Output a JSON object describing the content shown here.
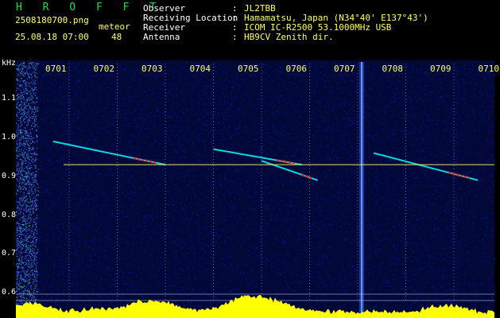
{
  "app": {
    "name": "H R O F F T"
  },
  "file": {
    "filename": "2508180700.png",
    "datetime": "25.08.18 07:00",
    "meteor_label": "meteor",
    "meteor_count": "48"
  },
  "station": {
    "fields": [
      {
        "label": "Observer",
        "sep": ":",
        "value": "JL2TBB"
      },
      {
        "label": "Receiving Location",
        "sep": ":",
        "value": "Hamamatsu, Japan (N34°40' E137°43')"
      },
      {
        "label": "Receiver",
        "sep": ":",
        "value": "ICOM IC-R2500 53.1000MHz USB"
      },
      {
        "label": "Antenna",
        "sep": ":",
        "value": "HB9CV Zenith dir."
      }
    ]
  },
  "chart_data": {
    "type": "heatmap",
    "title": "",
    "xlabel": "",
    "ylabel": "kHz",
    "x_ticks": [
      "0701",
      "0702",
      "0703",
      "0704",
      "0705",
      "0706",
      "0707",
      "0708",
      "0709",
      "0710"
    ],
    "y_ticks": [
      "1.1",
      "1.0",
      "0.9",
      "0.8",
      "0.7",
      "0.6"
    ],
    "ylim": [
      0.57,
      1.18
    ],
    "carrier_khz": 0.93,
    "meteor_echoes": [
      {
        "t_start": "07:00:40",
        "t_end": "07:03:00",
        "khz_start": 0.99,
        "khz_end": 0.93
      },
      {
        "t_start": "07:04:00",
        "t_end": "07:05:50",
        "khz_start": 0.97,
        "khz_end": 0.93
      },
      {
        "t_start": "07:05:00",
        "t_end": "07:06:10",
        "khz_start": 0.94,
        "khz_end": 0.89
      },
      {
        "t_start": "07:07:20",
        "t_end": "07:09:30",
        "khz_start": 0.96,
        "khz_end": 0.89
      }
    ],
    "colors": {
      "background": "#000000",
      "noise": "#0a14a0",
      "echo_low": "#00ffff",
      "echo_high": "#ff2020",
      "carrier": "#ffff66",
      "signal_level": "#ffff00",
      "axis_text": "#ffff66"
    }
  }
}
